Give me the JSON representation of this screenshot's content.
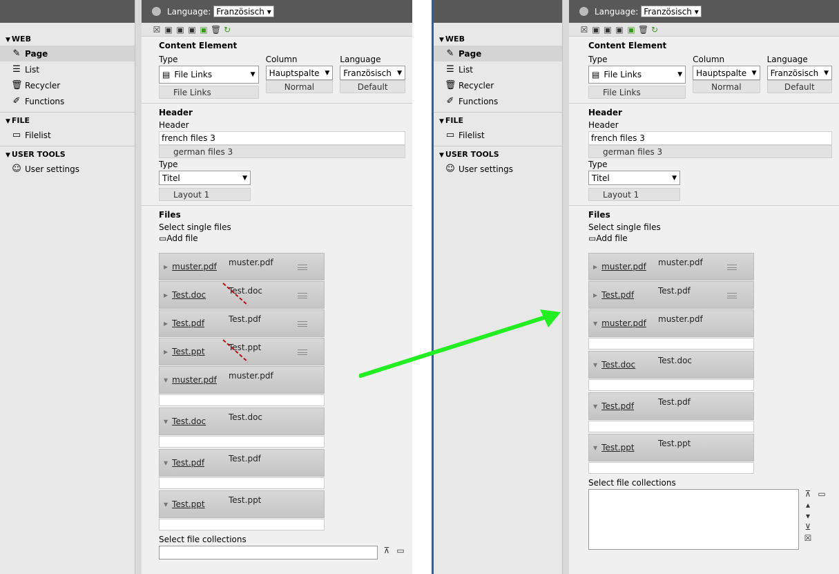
{
  "language_label": "Language:",
  "language_value": "Französisch",
  "nav": {
    "groups": [
      {
        "title": "WEB",
        "items": [
          "Page",
          "List",
          "Recycler",
          "Functions"
        ]
      },
      {
        "title": "FILE",
        "items": [
          "Filelist"
        ]
      },
      {
        "title": "USER TOOLS",
        "items": [
          "User settings"
        ]
      }
    ]
  },
  "content_element": {
    "title": "Content Element",
    "type_label": "Type",
    "type_value": "File Links",
    "type_orig": "File Links",
    "column_label": "Column",
    "column_value": "Hauptspalte",
    "column_orig": "Normal",
    "language_label": "Language",
    "language_value": "Französisch",
    "language_orig": "Default"
  },
  "header": {
    "title": "Header",
    "label": "Header",
    "value": "french files 3",
    "orig": "german files 3",
    "type_label": "Type",
    "type_value": "Titel",
    "type_orig": "Layout 1"
  },
  "files": {
    "title": "Files",
    "select_label": "Select single files",
    "add_label": "Add file",
    "collections_label": "Select file collections",
    "left_collapsed": [
      {
        "name": "muster.pdf",
        "orig": "muster.pdf"
      },
      {
        "name": "Test.doc",
        "orig": "Test.doc"
      },
      {
        "name": "Test.pdf",
        "orig": "Test.pdf"
      },
      {
        "name": "Test.ppt",
        "orig": "Test.ppt"
      }
    ],
    "left_expanded": [
      {
        "name": "muster.pdf",
        "orig": "muster.pdf"
      },
      {
        "name": "Test.doc",
        "orig": "Test.doc"
      },
      {
        "name": "Test.pdf",
        "orig": "Test.pdf"
      },
      {
        "name": "Test.ppt",
        "orig": "Test.ppt"
      }
    ],
    "right_collapsed": [
      {
        "name": "muster.pdf",
        "orig": "muster.pdf"
      },
      {
        "name": "Test.pdf",
        "orig": "Test.pdf"
      }
    ],
    "right_expanded": [
      {
        "name": "muster.pdf",
        "orig": "muster.pdf"
      },
      {
        "name": "Test.doc",
        "orig": "Test.doc"
      },
      {
        "name": "Test.pdf",
        "orig": "Test.pdf"
      },
      {
        "name": "Test.ppt",
        "orig": "Test.ppt"
      }
    ]
  },
  "colors": {
    "arrow": "#22ee22",
    "nav_bg": "#e8e8e8",
    "topbar": "#585858"
  }
}
